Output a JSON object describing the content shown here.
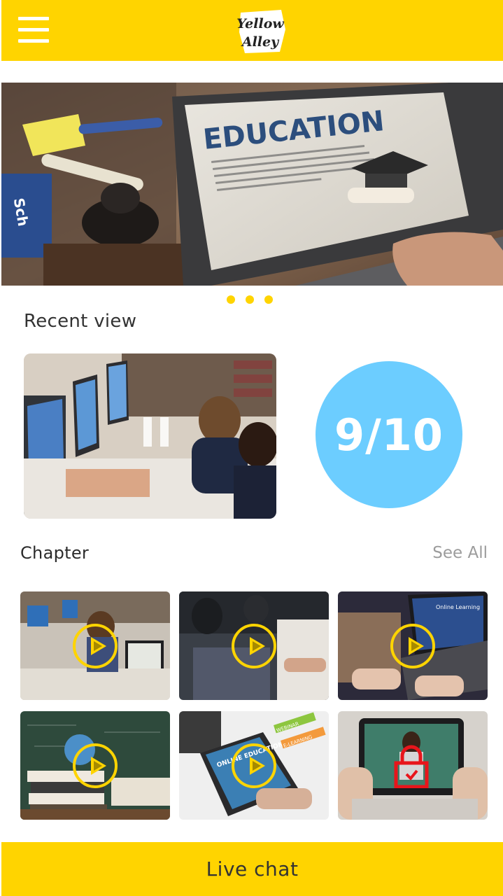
{
  "header": {
    "logo_line1": "Yellow",
    "logo_line2": "Alley",
    "menu_icon": "hamburger-menu-icon"
  },
  "banner": {
    "headline": "EDUCATION",
    "carousel_dots": 3
  },
  "recent": {
    "title": "Recent view",
    "score": "9/10",
    "pause_icon": "pause-icon"
  },
  "chapter": {
    "title": "Chapter",
    "see_all": "See All",
    "items": [
      {
        "icon": "play-icon",
        "locked": false
      },
      {
        "icon": "play-icon",
        "locked": false
      },
      {
        "icon": "play-icon",
        "locked": false,
        "screen_text": "Online Learning"
      },
      {
        "icon": "play-icon",
        "locked": false
      },
      {
        "icon": "play-icon",
        "locked": false,
        "screen_text": "ONLINE EDUCATION",
        "tag1": "WEBINAR",
        "tag2": "E-LEARNING"
      },
      {
        "icon": "lock-icon",
        "locked": true
      }
    ]
  },
  "footer": {
    "live_chat": "Live chat"
  },
  "colors": {
    "brand_yellow": "#FFD400",
    "score_blue": "#6CCDFF",
    "lock_red": "#E8151B"
  }
}
